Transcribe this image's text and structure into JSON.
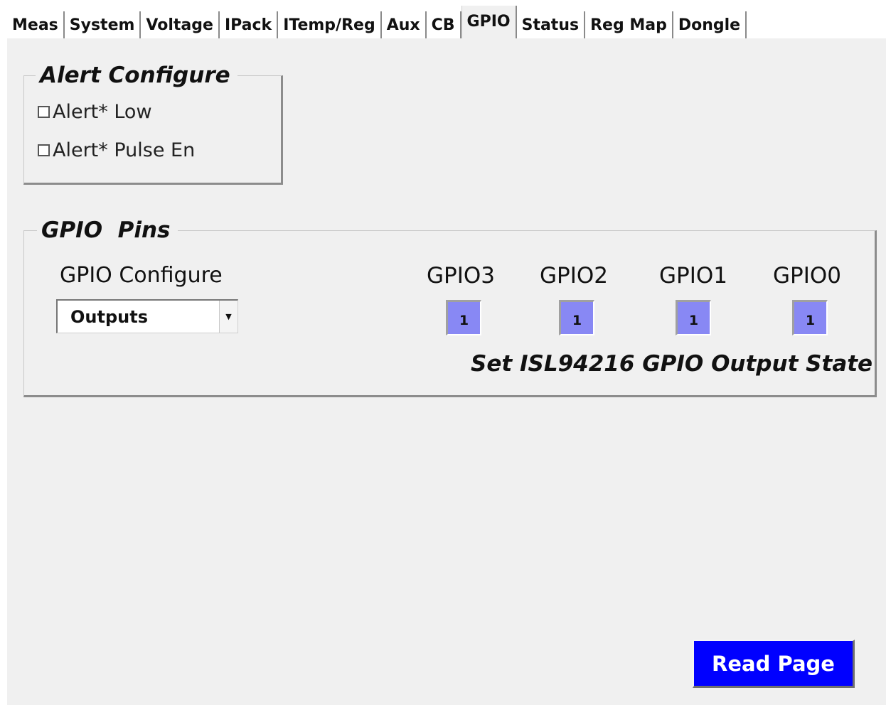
{
  "tabs": [
    {
      "label": "Meas"
    },
    {
      "label": "System"
    },
    {
      "label": "Voltage"
    },
    {
      "label": "IPack"
    },
    {
      "label": "ITemp/Reg"
    },
    {
      "label": "Aux"
    },
    {
      "label": "CB"
    },
    {
      "label": "GPIO",
      "active": true
    },
    {
      "label": "Status"
    },
    {
      "label": "Reg Map"
    },
    {
      "label": "Dongle"
    }
  ],
  "alert_configure": {
    "title": "Alert Configure",
    "options": [
      {
        "label": "Alert* Low",
        "checked": false
      },
      {
        "label": "Alert* Pulse En",
        "checked": false
      }
    ]
  },
  "gpio_pins": {
    "title": "GPIO  Pins",
    "configure_label": "GPIO Configure",
    "configure_value": "Outputs",
    "pins": [
      {
        "label": "GPIO3",
        "value": "1"
      },
      {
        "label": "GPIO2",
        "value": "1"
      },
      {
        "label": "GPIO1",
        "value": "1"
      },
      {
        "label": "GPIO0",
        "value": "1"
      }
    ],
    "caption": "Set ISL94216 GPIO Output State"
  },
  "read_button": "Read Page",
  "colors": {
    "panel_bg": "#f0f0f0",
    "pin_box": "#8888f4",
    "button_bg": "#0000ff",
    "button_text": "#ffffff"
  }
}
